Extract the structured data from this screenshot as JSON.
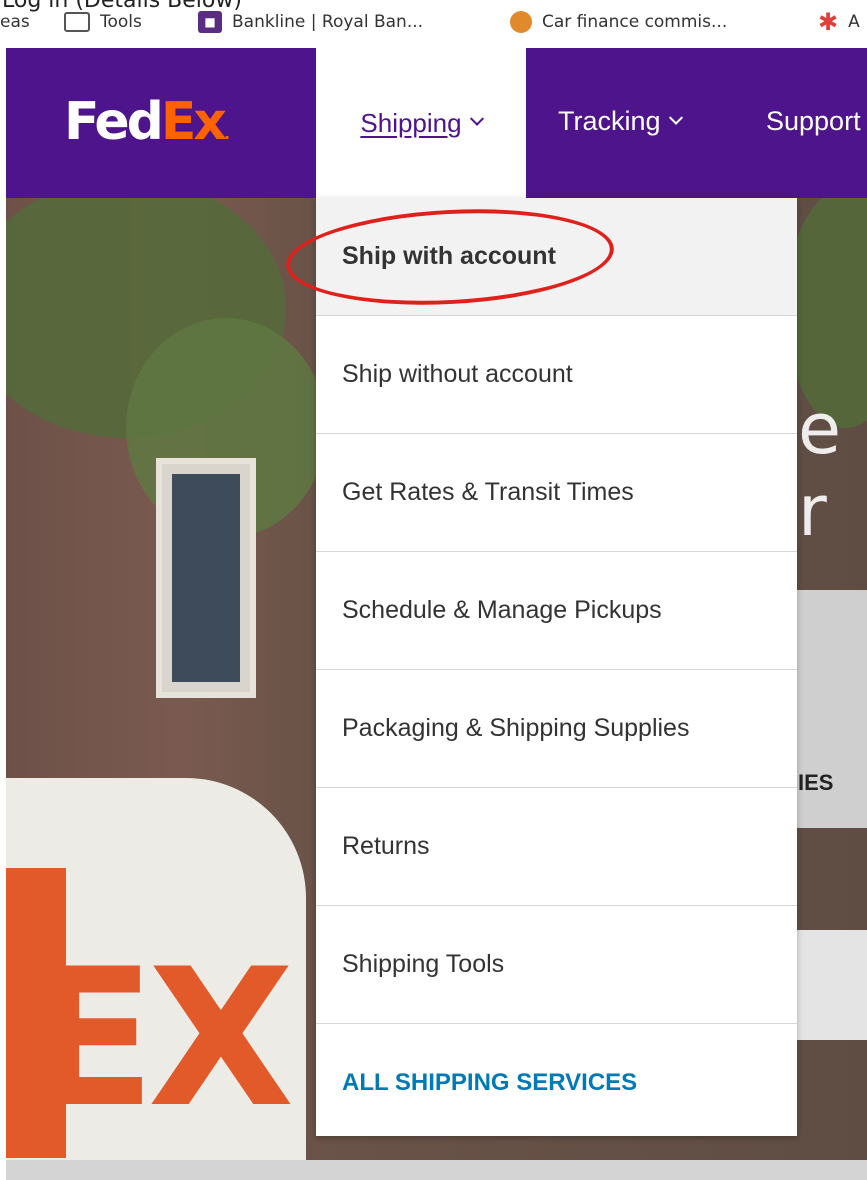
{
  "browser": {
    "clipped_title": "Log in (Details Below)",
    "bookmarks": [
      {
        "label": "eas",
        "icon": ""
      },
      {
        "label": "Tools",
        "icon": "folder-icon"
      },
      {
        "label": "Bankline | Royal Ban...",
        "icon": "bank-icon"
      },
      {
        "label": "Car finance commis...",
        "icon": "car-icon"
      },
      {
        "label": "A",
        "icon": "star-icon"
      }
    ]
  },
  "header": {
    "logo": {
      "fed": "Fed",
      "ex": "Ex",
      "dot": "."
    },
    "nav": {
      "shipping": "Shipping",
      "tracking": "Tracking",
      "support": "Support"
    },
    "colors": {
      "brand_purple": "#4d148c",
      "brand_orange": "#ff6200"
    }
  },
  "dropdown": {
    "items": [
      "Ship with account",
      "Ship without account",
      "Get Rates & Transit Times",
      "Schedule & Manage Pickups",
      "Packaging & Shipping Supplies",
      "Returns",
      "Shipping Tools",
      "ALL SHIPPING SERVICES"
    ],
    "link_color": "#007ab7"
  },
  "hero": {
    "partial_text": "e r",
    "side_label": "IES",
    "van_text": "EX"
  },
  "annotation": {
    "color": "#e0201b"
  }
}
